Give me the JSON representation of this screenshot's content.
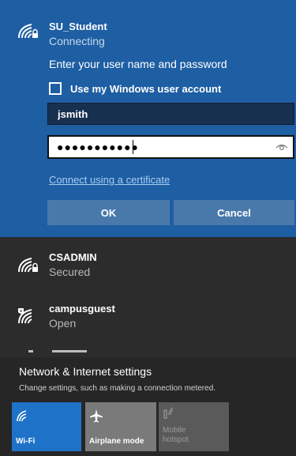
{
  "active_network": {
    "name": "SU_Student",
    "status": "Connecting",
    "prompt": "Enter your user name and password",
    "use_windows_account_label": "Use my Windows user account",
    "use_windows_account_checked": false,
    "username_value": "jsmith",
    "password_mask": "●●●●●●●●●●●",
    "certificate_link": "Connect using a certificate",
    "ok_label": "OK",
    "cancel_label": "Cancel",
    "icon": "wifi-secured-icon"
  },
  "networks": [
    {
      "name": "CSADMIN",
      "status": "Secured",
      "icon": "wifi-secured-icon"
    },
    {
      "name": "campusguest",
      "status": "Open",
      "icon": "wifi-open-shield-icon"
    }
  ],
  "footer": {
    "settings_title": "Network & Internet settings",
    "settings_subtitle": "Change settings, such as making a connection metered."
  },
  "quick_actions": [
    {
      "label": "Wi-Fi",
      "icon": "wifi-icon",
      "state": "on",
      "color": "#1e72c8"
    },
    {
      "label": "Airplane mode",
      "icon": "airplane-icon",
      "state": "off",
      "color": "#7a7a7a"
    },
    {
      "label_line1": "Mobile",
      "label_line2": "hotspot",
      "icon": "hotspot-icon",
      "state": "disabled",
      "color": "#5a5a5a"
    }
  ],
  "colors": {
    "accent": "#1e5ea3",
    "panel": "#2c2c2c",
    "link": "#a9cdf2"
  }
}
